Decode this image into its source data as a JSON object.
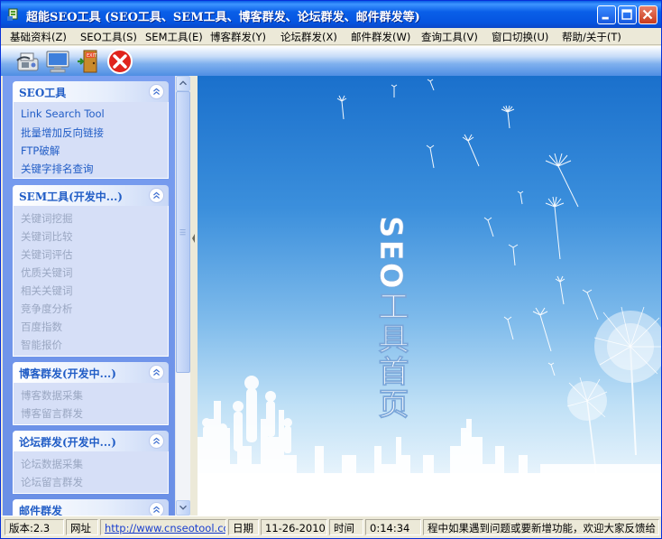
{
  "window": {
    "title": "超能SEO工具 (SEO工具、SEM工具、博客群发、论坛群发、邮件群发等)"
  },
  "menu": [
    "基础资料(Z)",
    "SEO工具(S)",
    "SEM工具(E)",
    "博客群发(Y)",
    "论坛群发(X)",
    "邮件群发(W)",
    "查询工具(V)",
    "窗口切换(U)",
    "帮助/关于(T)"
  ],
  "toolbar": {
    "icons": [
      "phone-fax-icon",
      "monitor-icon",
      "exit-door-icon",
      "close-red-icon"
    ]
  },
  "sidebar": {
    "groups": [
      {
        "title": "SEO工具",
        "items": [
          {
            "label": "Link Search Tool",
            "enabled": true
          },
          {
            "label": "批量增加反向链接",
            "enabled": true
          },
          {
            "label": "FTP破解",
            "enabled": true
          },
          {
            "label": "关键字排名查询",
            "enabled": true
          }
        ]
      },
      {
        "title": "SEM工具(开发中...)",
        "items": [
          {
            "label": "关键词挖掘",
            "enabled": false
          },
          {
            "label": "关键词比较",
            "enabled": false
          },
          {
            "label": "关键词评估",
            "enabled": false
          },
          {
            "label": "优质关键词",
            "enabled": false
          },
          {
            "label": "相关关键词",
            "enabled": false
          },
          {
            "label": "竞争度分析",
            "enabled": false
          },
          {
            "label": "百度指数",
            "enabled": false
          },
          {
            "label": "智能报价",
            "enabled": false
          }
        ]
      },
      {
        "title": "博客群发(开发中...)",
        "items": [
          {
            "label": "博客数据采集",
            "enabled": false
          },
          {
            "label": "博客留言群发",
            "enabled": false
          }
        ]
      },
      {
        "title": "论坛群发(开发中...)",
        "items": [
          {
            "label": "论坛数据采集",
            "enabled": false
          },
          {
            "label": "论坛留言群发",
            "enabled": false
          }
        ]
      },
      {
        "title": "邮件群发",
        "items": []
      }
    ]
  },
  "main": {
    "banner_text": "SEO工具首页"
  },
  "statusbar": {
    "version_label": "版本:2.3",
    "url_label": "网址",
    "url": "http://www.cnseotool.com",
    "date_label": "日期",
    "date": "11-26-2010",
    "time_label": "时间",
    "time": "0:14:34",
    "marquee": "程中如果遇到问题或要新增功能，欢迎大家反馈给"
  },
  "colors": {
    "titlebar": "#0554e0",
    "group_title": "#215dc6",
    "disabled_item": "#9aa7c2",
    "close_button": "#c83a1c"
  }
}
